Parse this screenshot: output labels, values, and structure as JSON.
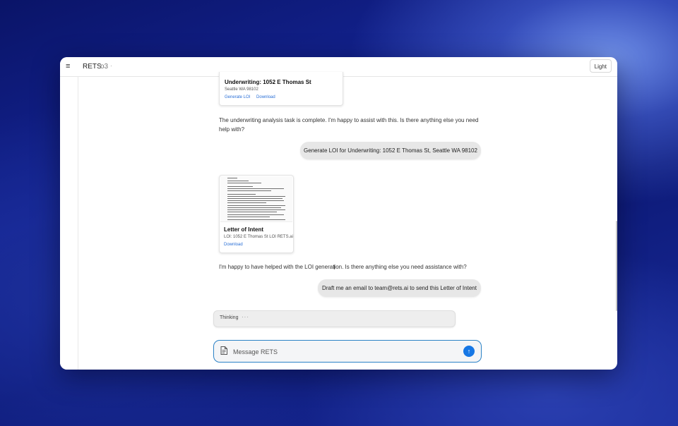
{
  "window": {
    "title": "RETS",
    "model": "o3",
    "model_caret": "·",
    "theme_button": "Light",
    "menu_icon": "≡"
  },
  "chat": {
    "underwriting_card": {
      "title": "Underwriting: 1052 E Thomas St",
      "subtitle": "Seattle WA 98102",
      "actions": [
        "Generate LOI",
        "Download"
      ]
    },
    "assistant_1": "The underwriting analysis task is complete. I'm happy to assist with this. Is there anything else you need help with?",
    "user_1": "Generate LOI for Underwriting: 1052 E Thomas St, Seattle WA 98102",
    "loi_card": {
      "title": "Letter of Intent",
      "subtitle": "LOI: 1052 E Thomas St LOI RETS.ai",
      "actions": [
        "Download"
      ]
    },
    "assistant_2": "I'm happy to have helped with the LOI generation. Is there anything else you need assistance with?",
    "user_2": "Draft me an email to team@rets.ai to send this Letter of Intent",
    "thinking": {
      "label": "Thinking",
      "dots": "···"
    }
  },
  "composer": {
    "placeholder": "Message RETS",
    "send_icon": "↑",
    "attach_icon": "document-icon"
  },
  "colors": {
    "accent": "#1677e5",
    "composer_border": "#2b82c6",
    "link": "#2a6fd6",
    "bubble": "#e7e7e7"
  }
}
